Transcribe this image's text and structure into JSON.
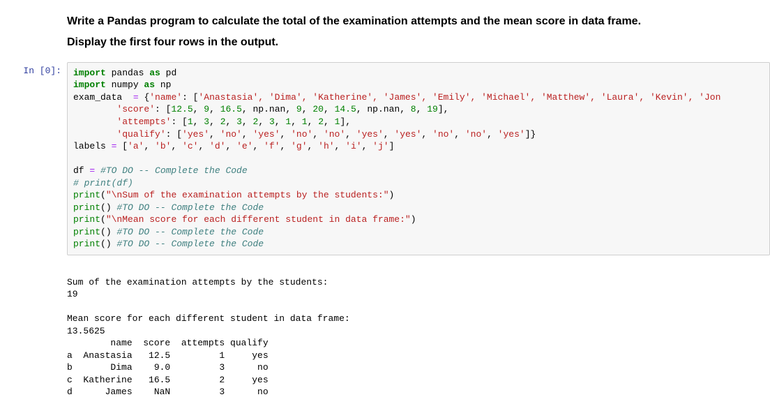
{
  "instructions": {
    "line1": "Write a Pandas program to calculate the total of the examination attempts and the mean score in data frame.",
    "line2": "Display the first four rows in the output."
  },
  "prompt_label": "In [0]:",
  "code": {
    "import1_kw1": "import",
    "import1_mod": " pandas ",
    "import1_kw2": "as",
    "import1_alias": " pd",
    "import2_kw1": "import",
    "import2_mod": " numpy ",
    "import2_kw2": "as",
    "import2_alias": " np",
    "exam_assign": "exam_data  ",
    "eq": "=",
    "brace_open": " {",
    "name_key": "'name'",
    "colon": ": [",
    "names_list": "'Anastasia', 'Dima', 'Katherine', 'James', 'Emily', 'Michael', 'Matthew', 'Laura', 'Kevin', 'Jon",
    "score_key": "        'score'",
    "score_vals": ": [12.5, 9, 16.5, np.nan, 9, 20, 14.5, np.nan, 8, 19],",
    "attempts_key": "        'attempts'",
    "attempts_vals": ": [1, 3, 2, 3, 2, 3, 1, 1, 2, 1],",
    "qualify_key": "        'qualify'",
    "qualify_vals": ": ['yes', 'no', 'yes', 'no', 'no', 'yes', 'yes', 'no', 'no', 'yes']}",
    "labels_assign": "labels ",
    "labels_vals": " ['a', 'b', 'c', 'd', 'e', 'f', 'g', 'h', 'i', 'j']",
    "blank": "",
    "df_assign": "df ",
    "todo1": " #TO DO -- Complete the Code",
    "comment_print": "# print(df)",
    "print_kw": "print",
    "sum_str": "\"\\nSum of the examination attempts by the students:\"",
    "todo2": " #TO DO -- Complete the Code",
    "mean_str": "\"\\nMean score for each different student in data frame:\"",
    "todo3": " #TO DO -- Complete the Code",
    "todo4": " #TO DO -- Complete the Code"
  },
  "output": {
    "line1": "",
    "line2": "Sum of the examination attempts by the students:",
    "line3": "19",
    "line4": "",
    "line5": "Mean score for each different student in data frame:",
    "line6": "13.5625",
    "header": "        name  score  attempts qualify",
    "row_a": "a  Anastasia   12.5         1     yes",
    "row_b": "b       Dima    9.0         3      no",
    "row_c": "c  Katherine   16.5         2     yes",
    "row_d": "d      James    NaN         3      no"
  }
}
